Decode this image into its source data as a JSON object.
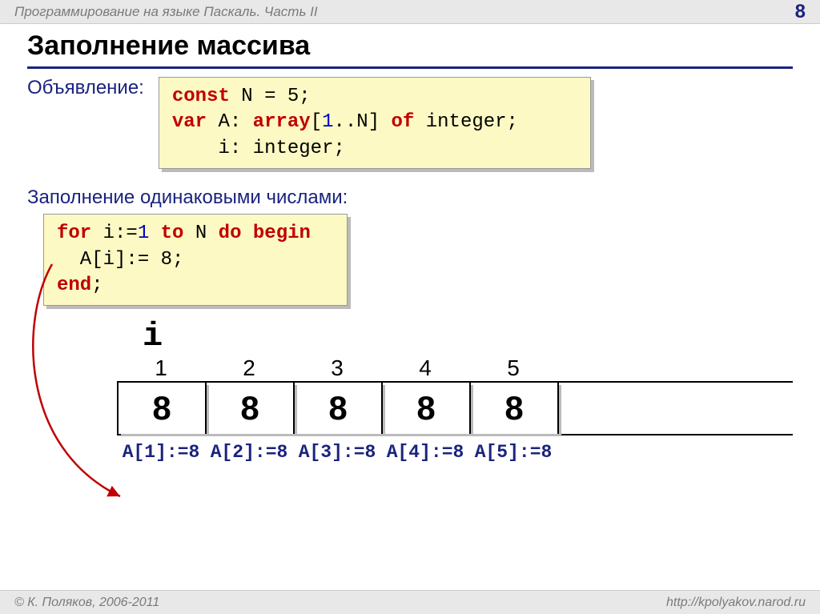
{
  "header": {
    "title": "Программирование на языке Паскаль. Часть II",
    "page": "8"
  },
  "title": "Заполнение массива",
  "section1": {
    "label": "Объявление:",
    "code": {
      "l1": {
        "kw": "const",
        "rest": " N = 5;"
      },
      "l2": {
        "kw": "var",
        "mid1": " A: ",
        "arr": "array",
        "b1": "[",
        "n1": "1",
        "b2": "..N] ",
        "of": "of",
        "type": " integer;"
      },
      "l3": "    i: integer;"
    }
  },
  "section2": {
    "label": "Заполнение одинаковыми числами:",
    "code": {
      "l1a": "for",
      "l1b": " i:=",
      "l1n": "1",
      "l1c": " ",
      "l1d": "to",
      "l1e": " N ",
      "l1f": "do",
      "l1g": " ",
      "l1h": "begin",
      "l2": "  A[i]:= 8;",
      "l3": "end",
      "l3b": ";"
    }
  },
  "array": {
    "i_label": "i",
    "indices": [
      "1",
      "2",
      "3",
      "4",
      "5"
    ],
    "values": [
      "8",
      "8",
      "8",
      "8",
      "8"
    ],
    "assigns": [
      "A[1]:=8",
      "A[2]:=8",
      "A[3]:=8",
      "A[4]:=8",
      "A[5]:=8"
    ]
  },
  "footer": {
    "copyright": "© К. Поляков, 2006-2011",
    "url": "http://kpolyakov.narod.ru"
  }
}
